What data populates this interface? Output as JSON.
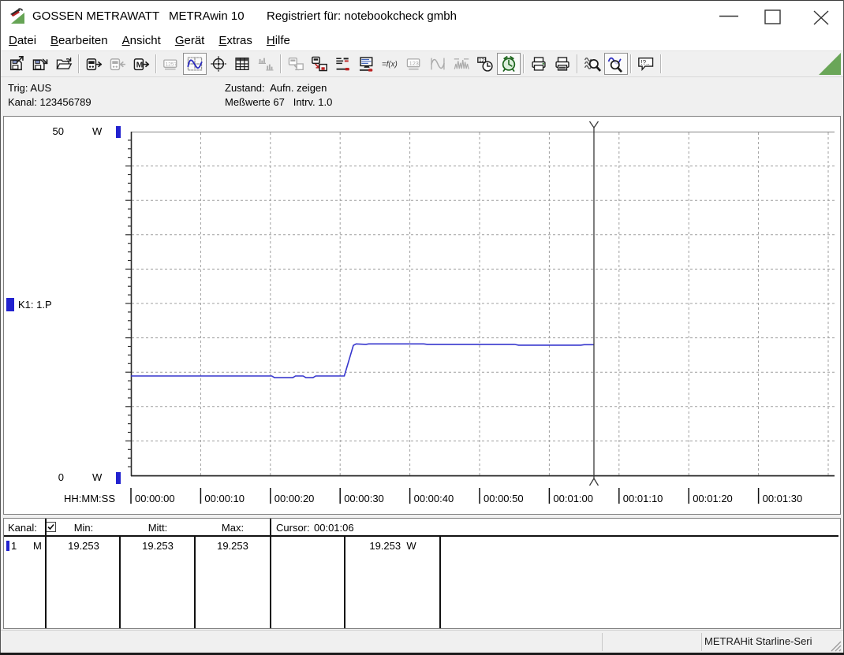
{
  "window": {
    "brand": "GOSSEN METRAWATT",
    "app": "METRAwin 10",
    "registered": "Registriert für: notebookcheck gmbh"
  },
  "menu": {
    "items": [
      "Datei",
      "Bearbeiten",
      "Ansicht",
      "Gerät",
      "Extras",
      "Hilfe"
    ]
  },
  "toolbar": {
    "groups": [
      [
        "save-export",
        "save-as",
        "open-file"
      ],
      [
        "device-read",
        "device-disconnect",
        "device-memory"
      ],
      [
        "display-lcd",
        "view-chart",
        "view-crosshair",
        "view-table",
        "view-histogram"
      ],
      [
        "export-data",
        "device-to-disk",
        "device-settings",
        "pc-connect",
        "formula-fx",
        "display-digits",
        "view-sine",
        "view-spectrum",
        "record-time",
        "record-timer"
      ],
      [
        "print",
        "print-preview"
      ],
      [
        "zoom-all",
        "zoom-select"
      ],
      [
        "tooltip-help"
      ]
    ],
    "pressed": [
      "view-chart",
      "record-timer",
      "zoom-select"
    ],
    "disabled": [
      "device-disconnect",
      "display-lcd",
      "view-histogram",
      "export-data",
      "display-digits",
      "view-sine",
      "view-spectrum"
    ]
  },
  "info": {
    "trig": "Trig: AUS",
    "kanal": "Kanal: 123456789",
    "zustand_label": "Zustand:",
    "zustand_value": "Aufn. zeigen",
    "messwerte": "Meßwerte 67",
    "intrv": "Intrv. 1.0"
  },
  "chart": {
    "y_max_label": "50",
    "y_min_label": "0",
    "unit": "W",
    "channel": "K1: 1.P",
    "x_caption": "HH:MM:SS"
  },
  "chart_data": {
    "type": "line",
    "ylabel": "W",
    "ylim": [
      0,
      50
    ],
    "x_unit": "seconds",
    "x_ticks_seconds": [
      0,
      10,
      20,
      30,
      40,
      50,
      60,
      70,
      80,
      90
    ],
    "x_tick_labels": [
      "00:00:00",
      "00:00:10",
      "00:00:20",
      "00:00:30",
      "00:00:40",
      "00:00:50",
      "00:01:00",
      "00:01:10",
      "00:01:20",
      "00:01:30"
    ],
    "grid": true,
    "series": [
      {
        "name": "K1: 1.P",
        "color": "#3636cd",
        "points": [
          [
            0,
            14.45
          ],
          [
            20.2,
            14.45
          ],
          [
            20.6,
            14.2
          ],
          [
            23.2,
            14.2
          ],
          [
            23.6,
            14.45
          ],
          [
            24.7,
            14.45
          ],
          [
            25.1,
            14.2
          ],
          [
            26.1,
            14.2
          ],
          [
            26.5,
            14.45
          ],
          [
            30.6,
            14.45
          ],
          [
            31.9,
            18.9
          ],
          [
            32.3,
            19.12
          ],
          [
            33.7,
            19.05
          ],
          [
            34.1,
            19.12
          ],
          [
            42,
            19.12
          ],
          [
            42.5,
            19.05
          ],
          [
            55,
            19.05
          ],
          [
            55.6,
            18.93
          ],
          [
            64.5,
            18.93
          ],
          [
            65,
            19.0
          ],
          [
            66.4,
            19.0
          ]
        ]
      }
    ],
    "cursor": {
      "label": "00:01:06",
      "t": 66.4,
      "value": "19.253",
      "unit": "W"
    }
  },
  "table": {
    "kanal_label": "Kanal:",
    "min_label": "Min:",
    "mitt_label": "Mitt:",
    "max_label": "Max:",
    "cursor_label": "Cursor:",
    "cursor_time": "00:01:06",
    "checkbox_checked": true,
    "row": {
      "channel": "1",
      "mode": "M",
      "min": "19.253",
      "mitt": "19.253",
      "max": "19.253",
      "cursor_value": "19.253",
      "unit": "W"
    }
  },
  "statusbar": {
    "device": "METRAHit Starline-Seri"
  }
}
